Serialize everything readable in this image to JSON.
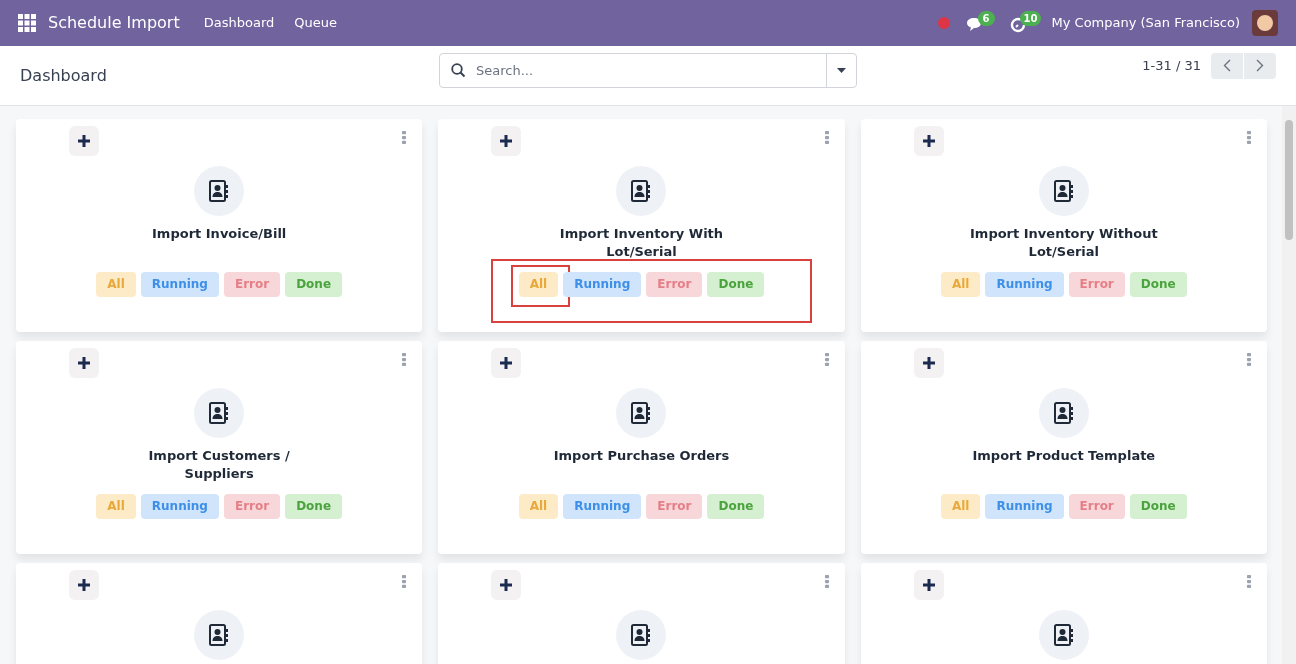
{
  "navbar": {
    "app_name": "Schedule Import",
    "menu": [
      {
        "label": "Dashboard"
      },
      {
        "label": "Queue"
      }
    ],
    "messages_badge": "6",
    "activities_badge": "10",
    "company": "My Company (San Francisco)"
  },
  "control_panel": {
    "breadcrumb": "Dashboard",
    "search": {
      "placeholder": "Search..."
    },
    "pager": "1-31 / 31"
  },
  "cards": [
    {
      "title": "Import Invoice/Bill",
      "highlighted": false,
      "filters": [
        {
          "label": "All",
          "kind": "all",
          "highlighted": false
        },
        {
          "label": "Running",
          "kind": "running",
          "highlighted": false
        },
        {
          "label": "Error",
          "kind": "error",
          "highlighted": false
        },
        {
          "label": "Done",
          "kind": "done",
          "highlighted": false
        }
      ]
    },
    {
      "title": "Import Inventory With Lot/Serial",
      "highlighted": true,
      "filters": [
        {
          "label": "All",
          "kind": "all",
          "highlighted": true
        },
        {
          "label": "Running",
          "kind": "running",
          "highlighted": false
        },
        {
          "label": "Error",
          "kind": "error",
          "highlighted": false
        },
        {
          "label": "Done",
          "kind": "done",
          "highlighted": false
        }
      ]
    },
    {
      "title": "Import Inventory Without Lot/Serial",
      "highlighted": false,
      "filters": [
        {
          "label": "All",
          "kind": "all",
          "highlighted": false
        },
        {
          "label": "Running",
          "kind": "running",
          "highlighted": false
        },
        {
          "label": "Error",
          "kind": "error",
          "highlighted": false
        },
        {
          "label": "Done",
          "kind": "done",
          "highlighted": false
        }
      ]
    },
    {
      "title": "Import Customers / Suppliers",
      "highlighted": false,
      "filters": [
        {
          "label": "All",
          "kind": "all",
          "highlighted": false
        },
        {
          "label": "Running",
          "kind": "running",
          "highlighted": false
        },
        {
          "label": "Error",
          "kind": "error",
          "highlighted": false
        },
        {
          "label": "Done",
          "kind": "done",
          "highlighted": false
        }
      ]
    },
    {
      "title": "Import Purchase Orders",
      "highlighted": false,
      "filters": [
        {
          "label": "All",
          "kind": "all",
          "highlighted": false
        },
        {
          "label": "Running",
          "kind": "running",
          "highlighted": false
        },
        {
          "label": "Error",
          "kind": "error",
          "highlighted": false
        },
        {
          "label": "Done",
          "kind": "done",
          "highlighted": false
        }
      ]
    },
    {
      "title": "Import Product Template",
      "highlighted": false,
      "filters": [
        {
          "label": "All",
          "kind": "all",
          "highlighted": false
        },
        {
          "label": "Running",
          "kind": "running",
          "highlighted": false
        },
        {
          "label": "Error",
          "kind": "error",
          "highlighted": false
        },
        {
          "label": "Done",
          "kind": "done",
          "highlighted": false
        }
      ]
    },
    {
      "highlighted": false
    },
    {
      "highlighted": false
    },
    {
      "highlighted": false
    }
  ]
}
